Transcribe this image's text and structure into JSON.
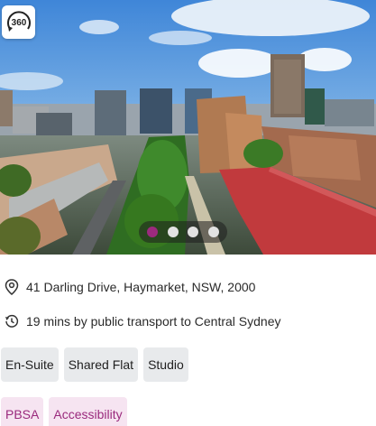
{
  "hero": {
    "image_description_icon": "panorama-360-icon",
    "badge_label": "360",
    "carousel": {
      "total": 4,
      "active_index": 0
    }
  },
  "property": {
    "address": "41 Darling Drive, Haymarket, NSW, 2000",
    "transport": "19 mins by public transport to Central Sydney"
  },
  "room_types": [
    "En-Suite",
    "Shared Flat",
    "Studio"
  ],
  "features": [
    "PBSA",
    "Accessibility"
  ],
  "colors": {
    "accent": "#9c2a7e",
    "tag_grey_bg": "#e8eaec",
    "tag_pink_bg": "#f6e4f1",
    "tag_pink_text": "#9a2a7d"
  },
  "icons": {
    "address": "location-pin-icon",
    "transport": "clock-history-icon"
  }
}
